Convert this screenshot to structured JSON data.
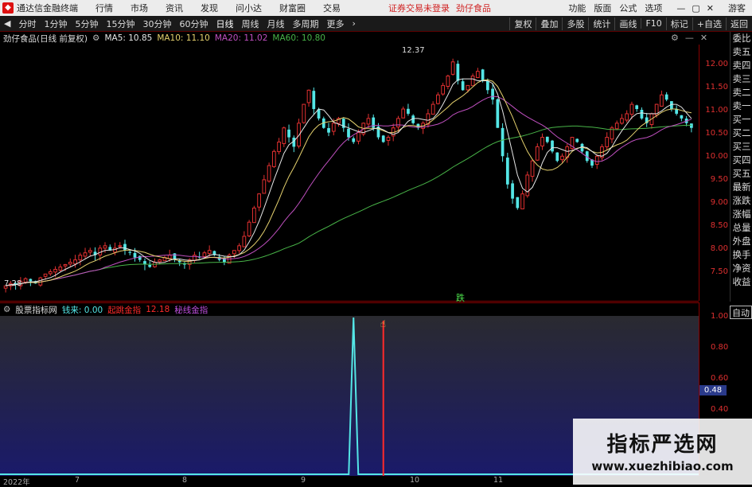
{
  "titlebar": {
    "app_name": "通达信金融终端",
    "menu": [
      "行情",
      "市场",
      "资讯",
      "发现",
      "问小达",
      "财富圈",
      "交易"
    ],
    "notice": "证券交易未登录",
    "stock_name": "劲仔食品",
    "right_menu": [
      "功能",
      "版面",
      "公式",
      "选项"
    ],
    "guest": "游客"
  },
  "toolbar": {
    "periods": [
      "分时",
      "1分钟",
      "5分钟",
      "15分钟",
      "30分钟",
      "60分钟",
      "日线",
      "周线",
      "月线",
      "多周期",
      "更多"
    ],
    "active_period": "日线",
    "right_buttons": [
      "复权",
      "叠加",
      "多股",
      "统计",
      "画线",
      "F10",
      "标记",
      "+自选",
      "返回"
    ]
  },
  "info": {
    "stock_title": "劲仔食品(日线 前复权)",
    "ma5": "MA5: 10.85",
    "ma10": "MA10: 11.10",
    "ma20": "MA20: 11.02",
    "ma60": "MA60: 10.80"
  },
  "annotations": {
    "high_label": "12.37",
    "low_label": "7.28",
    "signal_label": "跌"
  },
  "price_axis": [
    "12.00",
    "11.50",
    "11.00",
    "10.50",
    "10.00",
    "9.50",
    "9.00",
    "8.50",
    "8.00",
    "7.50"
  ],
  "side_tabs": [
    "委比",
    "卖五",
    "卖四",
    "卖三",
    "卖二",
    "卖一",
    "买一",
    "买二",
    "买三",
    "买四",
    "买五",
    "最新",
    "涨跌",
    "涨幅",
    "总量",
    "外盘",
    "换手",
    "净资",
    "收益"
  ],
  "sub_info": {
    "indicator_name": "股票指标网",
    "label1": "钱来: 0.00",
    "label2": "起跳金指",
    "value2": "12.18",
    "label3": "秘线金指"
  },
  "sub_axis": [
    "1.00",
    "0.80",
    "0.60",
    "0.40"
  ],
  "sub_current": "0.48",
  "auto_button": "自动",
  "time_axis": [
    {
      "label": "2022年"
    },
    {
      "label": "7"
    },
    {
      "label": "8"
    },
    {
      "label": "9"
    },
    {
      "label": "10"
    },
    {
      "label": "11"
    }
  ],
  "watermark": {
    "cn": "指标严选网",
    "en": "www.xuezhibiao.com"
  },
  "colors": {
    "up": "#e03030",
    "down": "#54e6e6",
    "ma5": "#e6e6e6",
    "ma10": "#e6d26e",
    "ma20": "#c050c0",
    "ma60": "#48b448",
    "accent": "#ff2a2a"
  },
  "chart_data": {
    "type": "candlestick",
    "ylim": [
      7.2,
      12.5
    ],
    "close": [
      7.45,
      7.5,
      7.48,
      7.55,
      7.6,
      7.55,
      7.5,
      7.62,
      7.7,
      7.75,
      7.8,
      7.85,
      7.9,
      7.95,
      8.0,
      8.1,
      8.15,
      8.2,
      8.1,
      8.25,
      8.3,
      8.2,
      8.25,
      8.3,
      8.2,
      8.15,
      8.05,
      8.0,
      7.9,
      7.85,
      7.95,
      8.0,
      8.05,
      8.1,
      8.0,
      7.95,
      7.9,
      8.0,
      8.1,
      8.05,
      8.15,
      8.2,
      8.1,
      8.0,
      7.95,
      8.1,
      8.2,
      8.3,
      8.5,
      8.8,
      9.1,
      9.4,
      9.7,
      10.0,
      10.3,
      10.5,
      10.8,
      10.6,
      10.4,
      10.9,
      11.3,
      11.6,
      11.2,
      11.0,
      10.8,
      10.7,
      10.9,
      11.0,
      10.8,
      10.6,
      10.5,
      10.7,
      10.9,
      11.0,
      10.8,
      10.6,
      10.5,
      10.6,
      10.8,
      11.0,
      11.2,
      11.1,
      10.9,
      10.8,
      10.9,
      11.1,
      11.3,
      11.5,
      11.7,
      11.9,
      12.2,
      11.8,
      11.6,
      11.7,
      11.9,
      12.0,
      11.8,
      11.6,
      11.4,
      10.8,
      10.2,
      9.6,
      9.3,
      9.1,
      9.4,
      9.8,
      10.1,
      10.4,
      10.6,
      10.5,
      10.3,
      10.1,
      10.2,
      10.4,
      10.6,
      10.5,
      10.3,
      10.1,
      10.0,
      10.2,
      10.4,
      10.6,
      10.8,
      10.9,
      11.0,
      11.1,
      11.3,
      11.2,
      11.0,
      10.9,
      11.1,
      11.3,
      11.5,
      11.4,
      11.2,
      11.1,
      11.0,
      10.9,
      10.8
    ]
  },
  "sub_chart_data": {
    "type": "line",
    "ylim": [
      0,
      1.0
    ],
    "spike_index": 70,
    "spike_value": 1.0,
    "marker_index": 76
  }
}
